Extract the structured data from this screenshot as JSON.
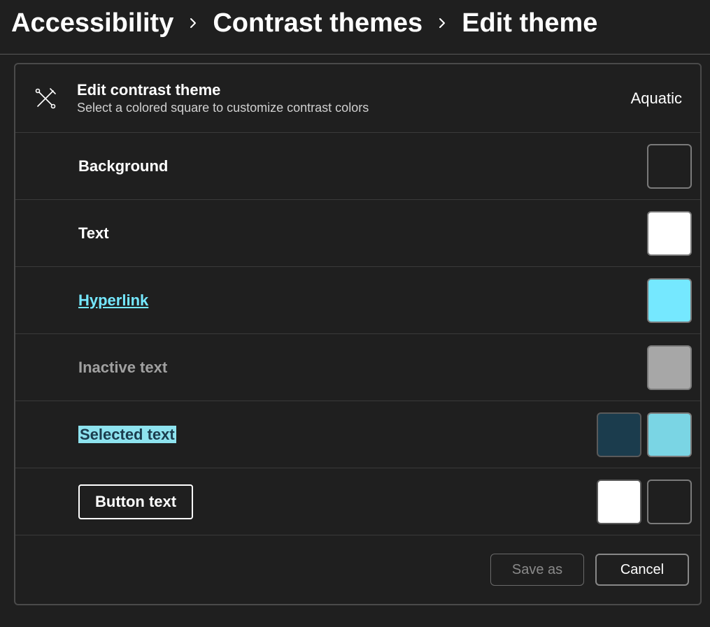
{
  "breadcrumb": {
    "items": [
      "Accessibility",
      "Contrast themes",
      "Edit theme"
    ]
  },
  "header": {
    "title": "Edit contrast theme",
    "subtitle": "Select a colored square to customize contrast colors",
    "theme_name": "Aquatic"
  },
  "rows": {
    "background": {
      "label": "Background",
      "color": "#1f1f1f",
      "border": "#7a7a7a"
    },
    "text": {
      "label": "Text",
      "color": "#ffffff",
      "border": "#7a7a7a"
    },
    "hyperlink": {
      "label": "Hyperlink",
      "color": "#75e8ff",
      "border": "#7a7a7a"
    },
    "inactive": {
      "label": "Inactive text",
      "color": "#a7a7a7",
      "border": "#7a7a7a"
    },
    "selected": {
      "label": "Selected text",
      "fg": "#1b3c4d",
      "bg": "#7ad5e4",
      "fg_border": "#5a5a5a",
      "bg_border": "#7a7a7a"
    },
    "button": {
      "label": "Button text",
      "fg": "#ffffff",
      "bg": "#1f1f1f",
      "fg_border": "#5a5a5a",
      "bg_border": "#7a7a7a"
    }
  },
  "footer": {
    "save_as_label": "Save as",
    "cancel_label": "Cancel"
  }
}
